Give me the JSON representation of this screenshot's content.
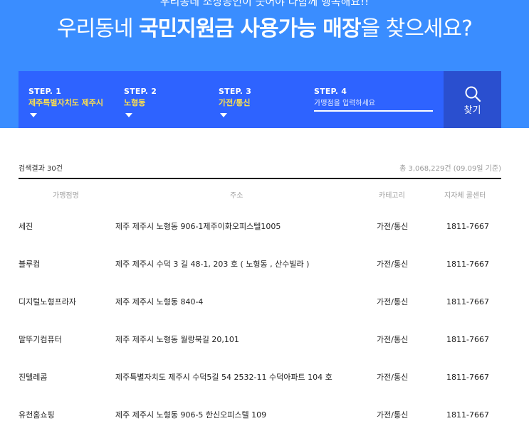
{
  "hero": {
    "subtitle": "우리동네 소상공인이 웃어야 다함께 행복해요!!",
    "title_pre": "우리동네 ",
    "title_bold1": "국민지원금 사용가능 매장",
    "title_mid": "을 찾으세요?"
  },
  "steps": [
    {
      "label": "STEP. 1",
      "value": "제주특별자치도 제주시"
    },
    {
      "label": "STEP. 2",
      "value": "노형동"
    },
    {
      "label": "STEP. 3",
      "value": "가전/통신"
    },
    {
      "label": "STEP. 4",
      "placeholder": "가맹점을 입력하세요"
    }
  ],
  "search": {
    "label": "찾기",
    "icon": "search-icon"
  },
  "results": {
    "count_label": "검색결과 30건",
    "total_label": "총 3,068,229건 (09.09일 기준)"
  },
  "table": {
    "headers": [
      "가맹점명",
      "주소",
      "카테고리",
      "지자체 콜센터"
    ],
    "rows": [
      {
        "name": "세진",
        "address": "제주 제주시 노형동 906-1제주이화오피스텔1005",
        "category": "가전/통신",
        "phone": "1811-7667"
      },
      {
        "name": "블루컴",
        "address": "제주 제주시 수덕 3 길 48-1, 203 호 ( 노형동 , 산수빌라 )",
        "category": "가전/통신",
        "phone": "1811-7667"
      },
      {
        "name": "디지털노형프라자",
        "address": "제주 제주시 노형동 840-4",
        "category": "가전/통신",
        "phone": "1811-7667"
      },
      {
        "name": "말뚜기컴퓨터",
        "address": "제주 제주시 노형동 월랑북길 20,101",
        "category": "가전/통신",
        "phone": "1811-7667"
      },
      {
        "name": "진텔레콤",
        "address": "제주특별자치도 제주시 수덕5길 54 2532-11 수덕아파트 104 호",
        "category": "가전/통신",
        "phone": "1811-7667"
      },
      {
        "name": "유천홈쇼핑",
        "address": "제주 제주시 노형동 906-5 한신오피스텔 109",
        "category": "가전/통신",
        "phone": "1811-7667"
      }
    ]
  },
  "colors": {
    "hero": "#3a8dff",
    "steps": "#2e63ff",
    "search": "#2a4fcf",
    "step_value": "#ffe14d"
  }
}
